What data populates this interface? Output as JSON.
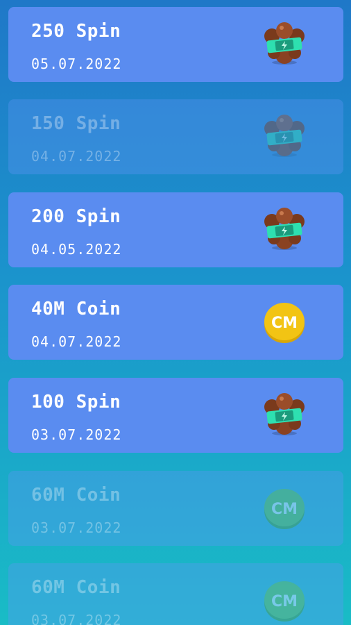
{
  "rewards": [
    {
      "title": "250 Spin",
      "date": "05.07.2022",
      "icon": "spin-capsule-icon",
      "claimed": false
    },
    {
      "title": "150 Spin",
      "date": "04.07.2022",
      "icon": "spin-capsule-icon",
      "claimed": true
    },
    {
      "title": "200 Spin",
      "date": "04.05.2022",
      "icon": "spin-capsule-icon",
      "claimed": false
    },
    {
      "title": "40M Coin",
      "date": "04.07.2022",
      "icon": "coin-icon",
      "claimed": false
    },
    {
      "title": "100 Spin",
      "date": "03.07.2022",
      "icon": "spin-capsule-icon",
      "claimed": false
    },
    {
      "title": "60M Coin",
      "date": "03.07.2022",
      "icon": "coin-icon",
      "claimed": true
    },
    {
      "title": "60M Coin",
      "date": "03.07.2022",
      "icon": "coin-icon",
      "claimed": true
    }
  ],
  "coin_label": "CM",
  "colors": {
    "card_active": "#5a8cf0",
    "coin_gold": "#f2c414",
    "coin_green": "#5fbf4f",
    "capsule_brown": "#9a4d2a",
    "capsule_teal": "#2ee0b0"
  }
}
